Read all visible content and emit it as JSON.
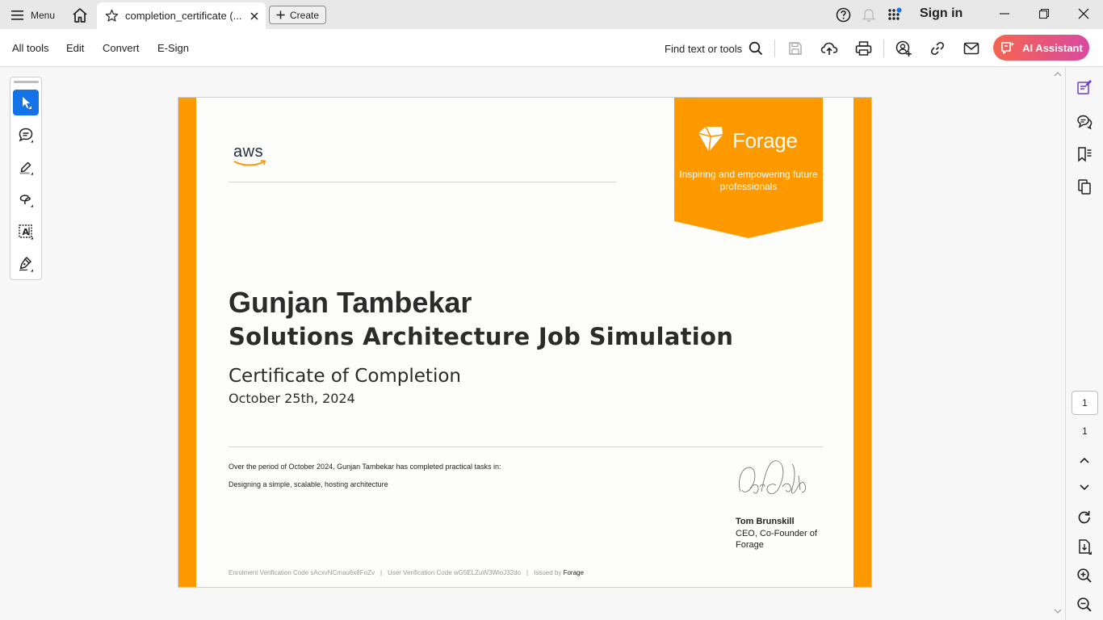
{
  "titlebar": {
    "menu_label": "Menu",
    "tab_title": "completion_certificate (...",
    "create_label": "Create",
    "sign_in": "Sign in"
  },
  "toolbar": {
    "menus": [
      "All tools",
      "Edit",
      "Convert",
      "E-Sign"
    ],
    "find_label": "Find text or tools",
    "ai_label": "AI Assistant"
  },
  "navigation": {
    "current_page": "1",
    "total_pages": "1"
  },
  "certificate": {
    "logo_text": "aws",
    "brand": "Forage",
    "tagline": "Inspiring and empowering future professionals",
    "recipient": "Gunjan Tambekar",
    "program": "Solutions Architecture Job Simulation",
    "type": "Certificate of Completion",
    "date": "October 25th, 2024",
    "period_text": "Over the period of October 2024, Gunjan Tambekar has completed practical tasks in:",
    "task": "Designing a simple, scalable, hosting architecture",
    "signer_name": "Tom Brunskill",
    "signer_role": "CEO, Co-Founder of Forage",
    "enrolment_code": "Enrolment Verification Code sAcxvNCmau6x8FoZv",
    "user_code": "User Verification Code wG5ELZuW3WioJ32do",
    "issued_by_label": "Issued by",
    "issuer": "Forage"
  },
  "colors": {
    "accent_orange": "#ff9900",
    "ai_gradient_start": "#f5654f",
    "ai_gradient_end": "#d94aa0",
    "select_tool_blue": "#1473e6"
  },
  "icons": {
    "titlebar": [
      "hamburger-icon",
      "home-icon",
      "star-icon",
      "close-tab-icon",
      "plus-icon",
      "help-icon",
      "bell-icon",
      "apps-grid-icon",
      "minimize-icon",
      "restore-icon",
      "close-window-icon"
    ],
    "toolbar": [
      "search-icon",
      "save-icon",
      "cloud-upload-icon",
      "print-icon",
      "share-user-icon",
      "link-icon",
      "email-icon",
      "ai-chat-icon"
    ],
    "palette": [
      "select-arrow-icon",
      "comment-icon",
      "highlight-pen-icon",
      "lasso-draw-icon",
      "text-select-icon",
      "sign-pen-icon"
    ],
    "rail": [
      "edit-pdf-icon",
      "comments-panel-icon",
      "bookmarks-icon",
      "pages-panel-icon",
      "chevron-up-icon",
      "chevron-down-icon",
      "rotate-icon",
      "page-fit-icon",
      "zoom-in-icon",
      "zoom-out-icon"
    ]
  }
}
